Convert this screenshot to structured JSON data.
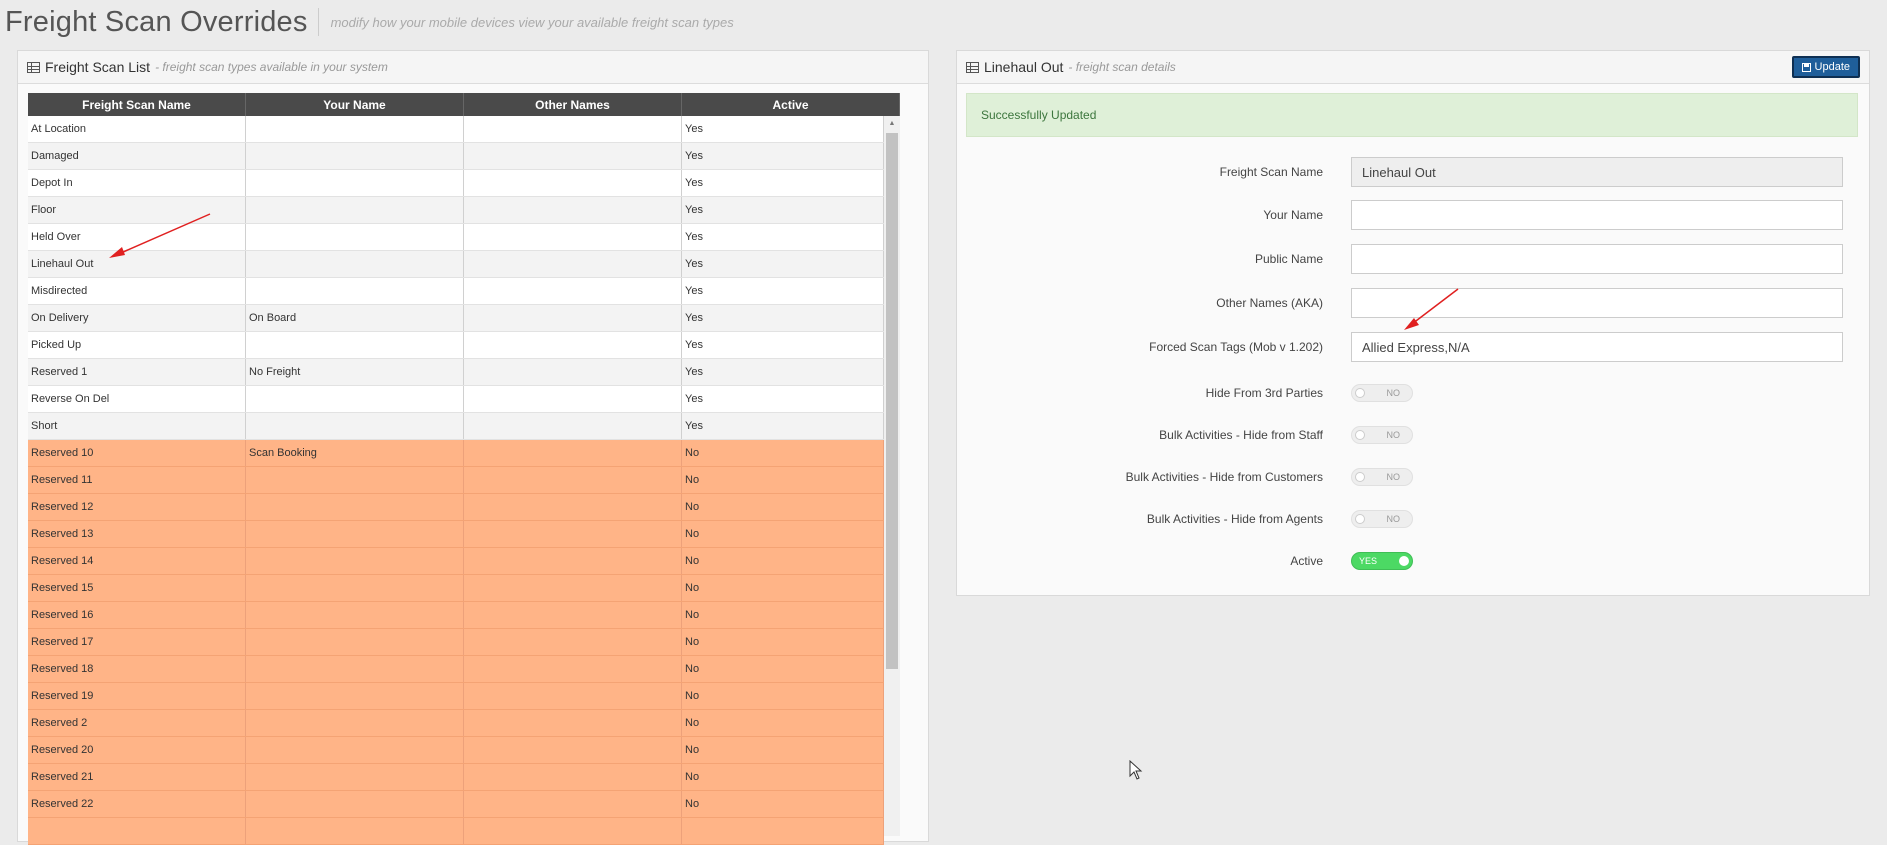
{
  "header": {
    "title": "Freight Scan Overrides",
    "subtitle": "modify how your mobile devices view your available freight scan types"
  },
  "left_panel": {
    "title": "Freight Scan List",
    "subtitle": "- freight scan types available in your system",
    "columns": [
      "Freight Scan Name",
      "Your Name",
      "Other Names",
      "Active"
    ],
    "rows": [
      {
        "name": "At Location",
        "your_name": "",
        "other_names": "",
        "active": "Yes"
      },
      {
        "name": "Damaged",
        "your_name": "",
        "other_names": "",
        "active": "Yes"
      },
      {
        "name": "Depot In",
        "your_name": "",
        "other_names": "",
        "active": "Yes"
      },
      {
        "name": "Floor",
        "your_name": "",
        "other_names": "",
        "active": "Yes"
      },
      {
        "name": "Held Over",
        "your_name": "",
        "other_names": "",
        "active": "Yes"
      },
      {
        "name": "Linehaul Out",
        "your_name": "",
        "other_names": "",
        "active": "Yes"
      },
      {
        "name": "Misdirected",
        "your_name": "",
        "other_names": "",
        "active": "Yes"
      },
      {
        "name": "On Delivery",
        "your_name": "On Board",
        "other_names": "",
        "active": "Yes"
      },
      {
        "name": "Picked Up",
        "your_name": "",
        "other_names": "",
        "active": "Yes"
      },
      {
        "name": "Reserved 1",
        "your_name": "No Freight",
        "other_names": "",
        "active": "Yes"
      },
      {
        "name": "Reverse On Del",
        "your_name": "",
        "other_names": "",
        "active": "Yes"
      },
      {
        "name": "Short",
        "your_name": "",
        "other_names": "",
        "active": "Yes"
      },
      {
        "name": "Reserved 10",
        "your_name": "Scan Booking",
        "other_names": "",
        "active": "No"
      },
      {
        "name": "Reserved 11",
        "your_name": "",
        "other_names": "",
        "active": "No"
      },
      {
        "name": "Reserved 12",
        "your_name": "",
        "other_names": "",
        "active": "No"
      },
      {
        "name": "Reserved 13",
        "your_name": "",
        "other_names": "",
        "active": "No"
      },
      {
        "name": "Reserved 14",
        "your_name": "",
        "other_names": "",
        "active": "No"
      },
      {
        "name": "Reserved 15",
        "your_name": "",
        "other_names": "",
        "active": "No"
      },
      {
        "name": "Reserved 16",
        "your_name": "",
        "other_names": "",
        "active": "No"
      },
      {
        "name": "Reserved 17",
        "your_name": "",
        "other_names": "",
        "active": "No"
      },
      {
        "name": "Reserved 18",
        "your_name": "",
        "other_names": "",
        "active": "No"
      },
      {
        "name": "Reserved 19",
        "your_name": "",
        "other_names": "",
        "active": "No"
      },
      {
        "name": "Reserved 2",
        "your_name": "",
        "other_names": "",
        "active": "No"
      },
      {
        "name": "Reserved 20",
        "your_name": "",
        "other_names": "",
        "active": "No"
      },
      {
        "name": "Reserved 21",
        "your_name": "",
        "other_names": "",
        "active": "No"
      },
      {
        "name": "Reserved 22",
        "your_name": "",
        "other_names": "",
        "active": "No"
      },
      {
        "name": "",
        "your_name": "",
        "other_names": "",
        "active": ""
      }
    ]
  },
  "right_panel": {
    "title": "Linehaul Out",
    "subtitle": "- freight scan details",
    "update_label": "Update",
    "alert": "Successfully Updated",
    "fields": {
      "freight_scan_name": {
        "label": "Freight Scan Name",
        "value": "Linehaul Out"
      },
      "your_name": {
        "label": "Your Name",
        "value": ""
      },
      "public_name": {
        "label": "Public Name",
        "value": ""
      },
      "other_names": {
        "label": "Other Names (AKA)",
        "value": ""
      },
      "forced_scan_tags": {
        "label": "Forced Scan Tags (Mob v 1.202)",
        "value": "Allied Express,N/A"
      }
    },
    "toggles": [
      {
        "label": "Hide From 3rd Parties",
        "state": "NO"
      },
      {
        "label": "Bulk Activities - Hide from Staff",
        "state": "NO"
      },
      {
        "label": "Bulk Activities - Hide from Customers",
        "state": "NO"
      },
      {
        "label": "Bulk Activities - Hide from Agents",
        "state": "NO"
      },
      {
        "label": "Active",
        "state": "YES"
      }
    ]
  },
  "colors": {
    "inactive_row": "#ffb487",
    "success_bg": "#dff0d8",
    "toggle_on": "#4cd964",
    "update_button": "#1f5e9a",
    "annotation_arrow": "#e02020"
  }
}
